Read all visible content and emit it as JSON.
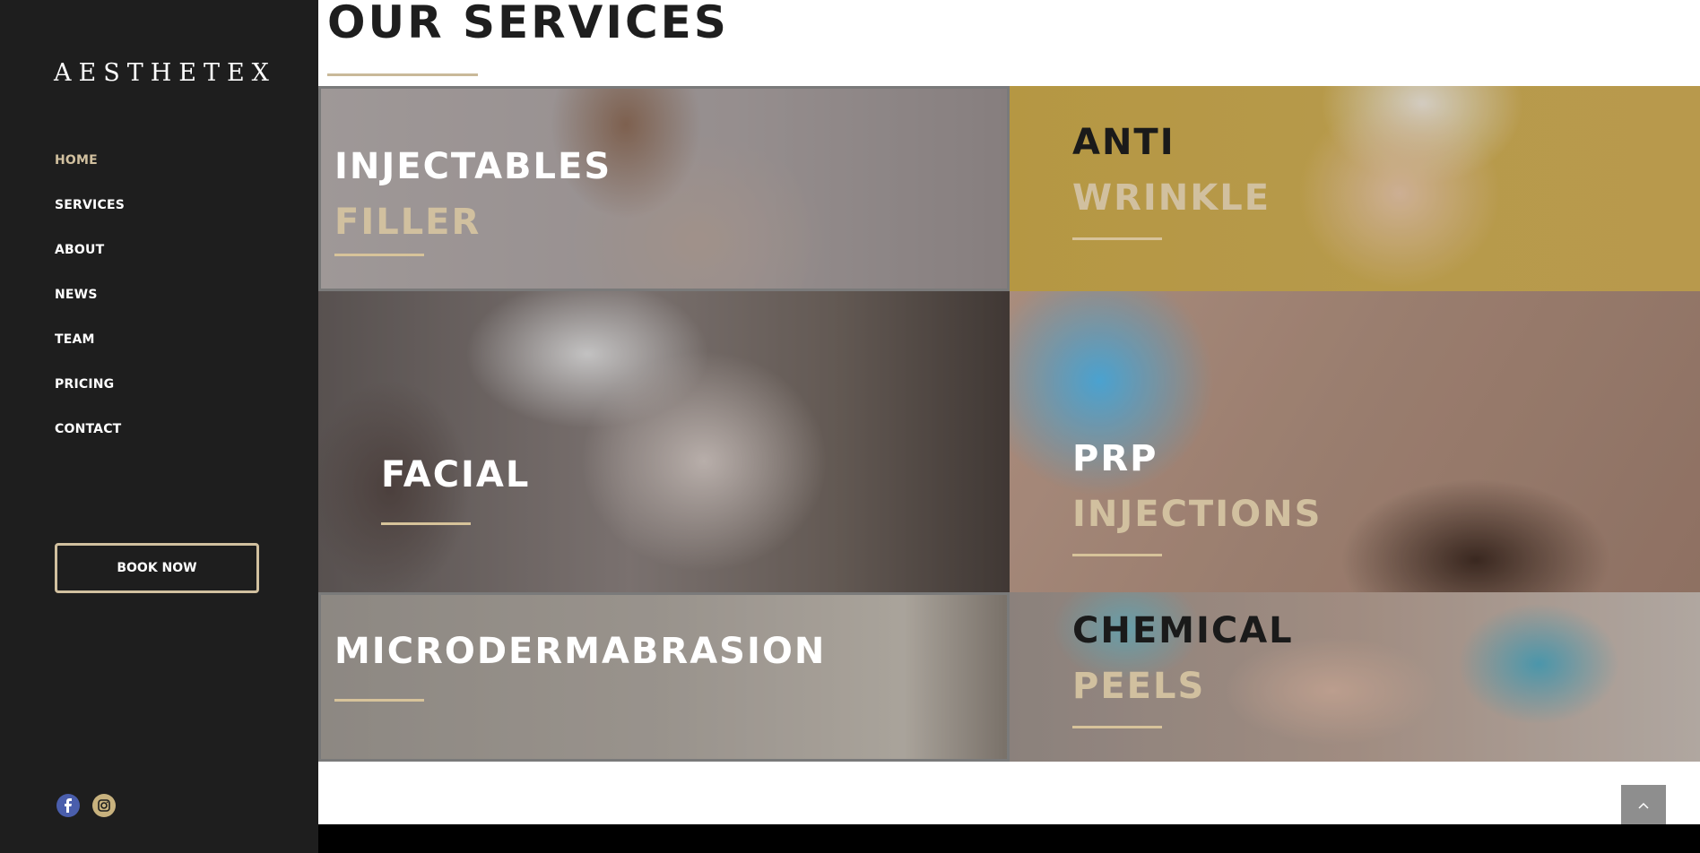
{
  "brand": {
    "logo_text": "AESTHETEX"
  },
  "nav": {
    "items": [
      {
        "label": "HOME",
        "active": true
      },
      {
        "label": "SERVICES"
      },
      {
        "label": "ABOUT"
      },
      {
        "label": "NEWS"
      },
      {
        "label": "TEAM"
      },
      {
        "label": "PRICING"
      },
      {
        "label": "CONTACT"
      }
    ]
  },
  "cta": {
    "book_label": "BOOK NOW"
  },
  "social": {
    "icons": [
      "facebook-icon",
      "instagram-icon"
    ]
  },
  "main": {
    "title": "OUR SERVICES",
    "tiles": [
      {
        "line1": "INJECTABLES",
        "line2": "FILLER"
      },
      {
        "line1": "ANTI",
        "line2": "WRINKLE"
      },
      {
        "line1": "FACIAL",
        "line2": ""
      },
      {
        "line1": "PRP",
        "line2": "INJECTIONS"
      },
      {
        "line1": "MICRODERMABRASION",
        "line2": ""
      },
      {
        "line1": "CHEMICAL",
        "line2": "PEELS"
      }
    ]
  },
  "colors": {
    "accent": "#d1c09f",
    "sidebar_bg": "#1e1e1e",
    "text_dark": "#1e1e1e"
  },
  "scroll_top_icon": "chevron-up-icon"
}
